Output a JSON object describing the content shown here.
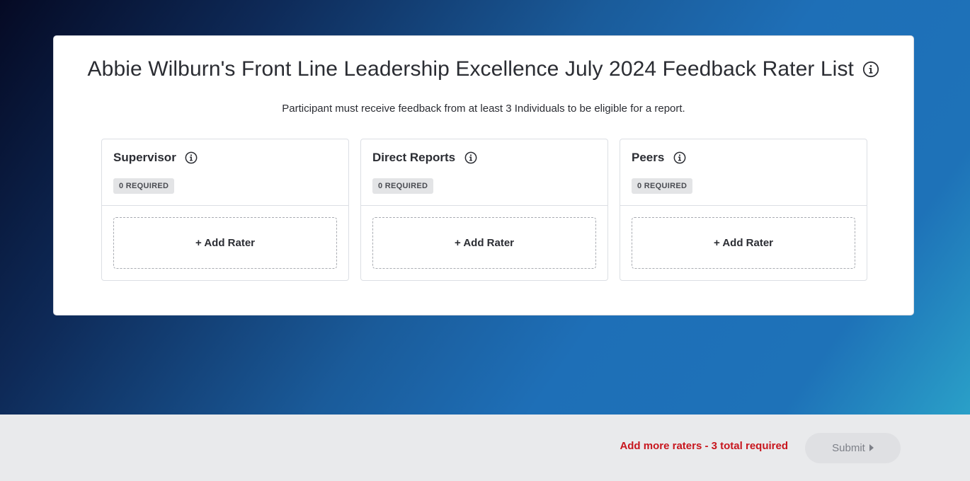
{
  "page": {
    "title": "Abbie Wilburn's Front Line Leadership Excellence July 2024 Feedback Rater List",
    "subtitle": "Participant must receive feedback from at least 3 Individuals to be eligible for a report."
  },
  "groups": [
    {
      "name": "Supervisor",
      "required": "0 REQUIRED",
      "add_label": "+ Add Rater"
    },
    {
      "name": "Direct Reports",
      "required": "0 REQUIRED",
      "add_label": "+ Add Rater"
    },
    {
      "name": "Peers",
      "required": "0 REQUIRED",
      "add_label": "+ Add Rater"
    }
  ],
  "footer": {
    "message": "Add more raters - 3 total required",
    "submit_label": "Submit"
  },
  "icons": {
    "title_info": "info-icon",
    "group_info": "info-icon",
    "submit_caret": "caret-right-icon"
  },
  "colors": {
    "error_text": "#c8161e",
    "footer_bg": "#e9eaec",
    "submit_disabled_bg": "#dfe0e3"
  }
}
